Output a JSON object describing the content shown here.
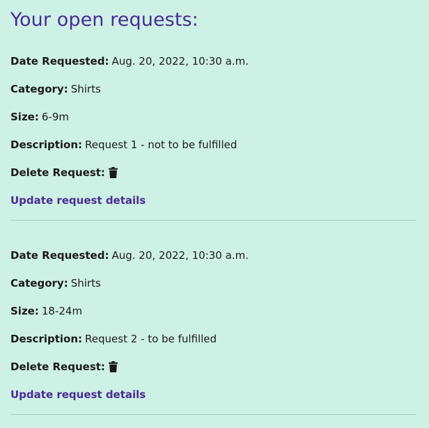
{
  "page_title": "Your open requests:",
  "labels": {
    "date_requested": "Date Requested:",
    "category": "Category:",
    "size": "Size:",
    "description": "Description:",
    "delete_request": "Delete Request:",
    "update_link": "Update request details"
  },
  "requests": [
    {
      "date_requested": "Aug. 20, 2022, 10:30 a.m.",
      "category": "Shirts",
      "size": "6-9m",
      "description": "Request 1 - not to be fulfilled"
    },
    {
      "date_requested": "Aug. 20, 2022, 10:30 a.m.",
      "category": "Shirts",
      "size": "18-24m",
      "description": "Request 2 - to be fulfilled"
    }
  ],
  "icons": {
    "delete": "trash-icon"
  },
  "colors": {
    "background": "#cdf1e5",
    "accent": "#4a2c93",
    "text": "#1b1b1b",
    "divider": "#a9cfc2"
  }
}
